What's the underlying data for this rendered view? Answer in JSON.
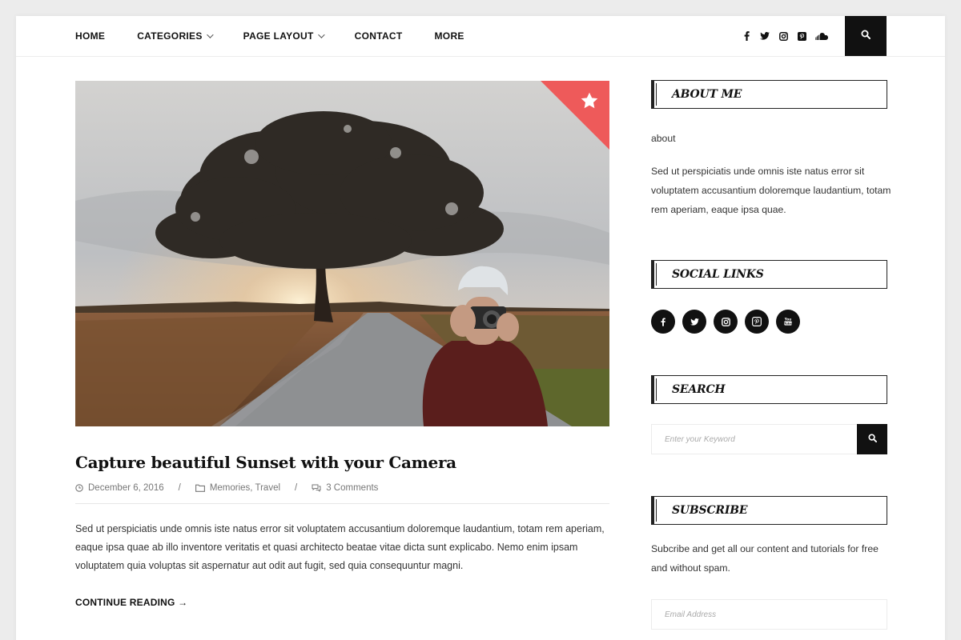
{
  "nav": {
    "items": [
      {
        "label": "HOME",
        "dropdown": false
      },
      {
        "label": "CATEGORIES",
        "dropdown": true
      },
      {
        "label": "PAGE LAYOUT",
        "dropdown": true
      },
      {
        "label": "CONTACT",
        "dropdown": false
      },
      {
        "label": "MORE",
        "dropdown": false
      }
    ],
    "social_icons": [
      "facebook-icon",
      "twitter-icon",
      "instagram-icon",
      "pinterest-icon",
      "soundcloud-icon"
    ],
    "search_icon": "search-icon"
  },
  "post": {
    "title": "Capture beautiful Sunset with your Camera",
    "date": "December 6, 2016",
    "categories": "Memories, Travel",
    "comments": "3 Comments",
    "separator": "/",
    "excerpt": "Sed ut perspiciatis unde omnis iste natus error sit voluptatem accusantium doloremque laudantium, totam rem aperiam, eaque ipsa quae ab illo inventore veritatis et quasi architecto beatae vitae dicta sunt explicabo. Nemo enim ipsam voluptatem quia voluptas sit aspernatur aut odit aut fugit, sed quia consequuntur magni.",
    "read_more": "CONTINUE READING →",
    "featured_badge_icon": "star-icon"
  },
  "sidebar": {
    "about": {
      "title": "ABOUT ME",
      "subtitle": "about",
      "text": "Sed ut perspiciatis unde omnis iste natus error sit voluptatem accusantium doloremque laudantium, totam rem aperiam, eaque ipsa quae."
    },
    "social": {
      "title": "SOCIAL LINKS",
      "icons": [
        "facebook-icon",
        "twitter-icon",
        "instagram-icon",
        "pinterest-icon",
        "youtube-icon"
      ]
    },
    "search": {
      "title": "SEARCH",
      "placeholder": "Enter your Keyword"
    },
    "subscribe": {
      "title": "SUBSCRIBE",
      "text": "Subcribe and get all our content and tutorials for free and without spam.",
      "placeholder": "Email Address"
    }
  },
  "colors": {
    "accent": "#ee5a5a",
    "dark": "#111111",
    "border": "#ececec"
  }
}
